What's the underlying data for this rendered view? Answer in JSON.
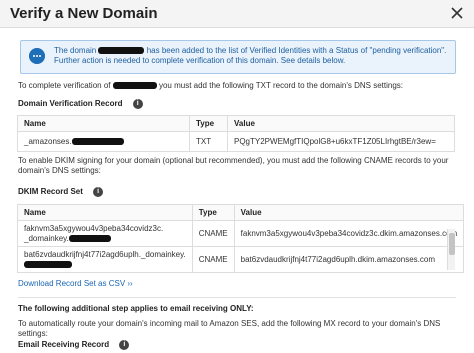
{
  "dialog": {
    "title": "Verify a New Domain"
  },
  "info_box": {
    "text_before": "The domain",
    "text_after": "has been added to the list of Verified Identities with a Status of \"pending verification\". Further action is needed to complete verification of this domain. See details below."
  },
  "txt_section": {
    "intro_before": "To complete verification of",
    "intro_after": "you must add the following TXT record to the domain's DNS settings:",
    "title": "Domain Verification Record",
    "headers": {
      "name": "Name",
      "type": "Type",
      "value": "Value"
    },
    "row": {
      "name_prefix": "_amazonses.",
      "type": "TXT",
      "value": "PQgTY2PWEMgfTIQpolG8+u6kxTF1Z05LIrhgtBE/r3ew="
    }
  },
  "dkim_section": {
    "intro": "To enable DKIM signing for your domain (optional but recommended), you must add the following CNAME records to your domain's DNS settings:",
    "title": "DKIM Record Set",
    "headers": {
      "name": "Name",
      "type": "Type",
      "value": "Value"
    },
    "rows": [
      {
        "name_line1": "faknvm3a5xgywou4v3peba34covidz3c.",
        "name_line2": "_domainkey.",
        "type": "CNAME",
        "value": "faknvm3a5xgywou4v3peba34covidz3c.dkim.amazonses.com"
      },
      {
        "name_line1": "bat6zvdaudkrijfnj4t77i2agd6uplh._domainkey.",
        "type": "CNAME",
        "value": "bat6zvdaudkrijfnj4t77i2agd6uplh.dkim.amazonses.com"
      }
    ],
    "csv_link": "Download Record Set as CSV ››"
  },
  "mx_section": {
    "title_line": "The following additional step applies to email receiving ONLY:",
    "intro": "To automatically route your domain's incoming mail to Amazon SES, add the following MX record to your domain's DNS settings:",
    "title": "Email Receiving Record"
  },
  "icons": {
    "close": "close-icon",
    "info": "chat-info-icon",
    "help": "help-icon"
  },
  "colors": {
    "info_bg": "#eaf3fb",
    "info_border": "#a5c8e8",
    "info_text": "#1e5fa0",
    "link": "#1a66b5"
  }
}
